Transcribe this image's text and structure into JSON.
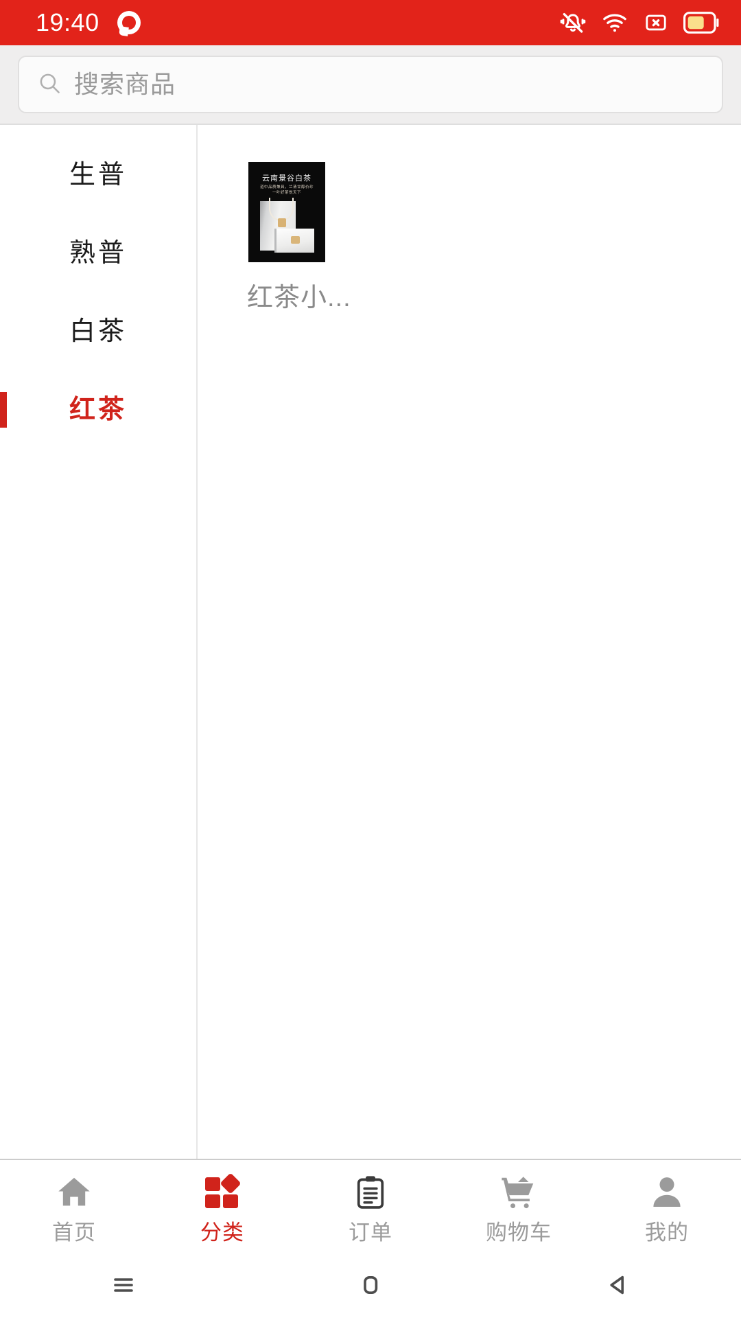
{
  "status_bar": {
    "time": "19:40",
    "app_logo_name": "qq-logo-icon",
    "icons": [
      "mute-bell-icon",
      "wifi-icon",
      "sim-card-x-icon",
      "battery-icon"
    ],
    "background_color": "#e2231a"
  },
  "search": {
    "placeholder": "搜索商品",
    "icon": "search-icon"
  },
  "sidebar": {
    "items": [
      {
        "label": "生普",
        "active": false
      },
      {
        "label": "熟普",
        "active": false
      },
      {
        "label": "白茶",
        "active": false
      },
      {
        "label": "红茶",
        "active": true
      }
    ],
    "active_color": "#d0231b"
  },
  "products": [
    {
      "name": "红茶小...",
      "image": {
        "title": "云南景谷白茶",
        "subtitle_line1": "道中品质兼具，兰清甘醇价珍",
        "subtitle_line2": "一叶好茶悦天下",
        "background_color": "#0a0a0a"
      }
    }
  ],
  "tabbar": {
    "items": [
      {
        "label": "首页",
        "icon": "home-icon",
        "active": false
      },
      {
        "label": "分类",
        "icon": "grid-icon",
        "active": true
      },
      {
        "label": "订单",
        "icon": "clipboard-icon",
        "active": false
      },
      {
        "label": "购物车",
        "icon": "cart-icon",
        "active": false
      },
      {
        "label": "我的",
        "icon": "person-icon",
        "active": false
      }
    ],
    "active_color": "#d0231b",
    "inactive_color": "#9b9b9b"
  },
  "android_nav": {
    "buttons": [
      {
        "name": "recents-button",
        "icon": "hamburger-icon"
      },
      {
        "name": "home-button",
        "icon": "rounded-square-icon"
      },
      {
        "name": "back-button",
        "icon": "triangle-left-icon"
      }
    ]
  }
}
